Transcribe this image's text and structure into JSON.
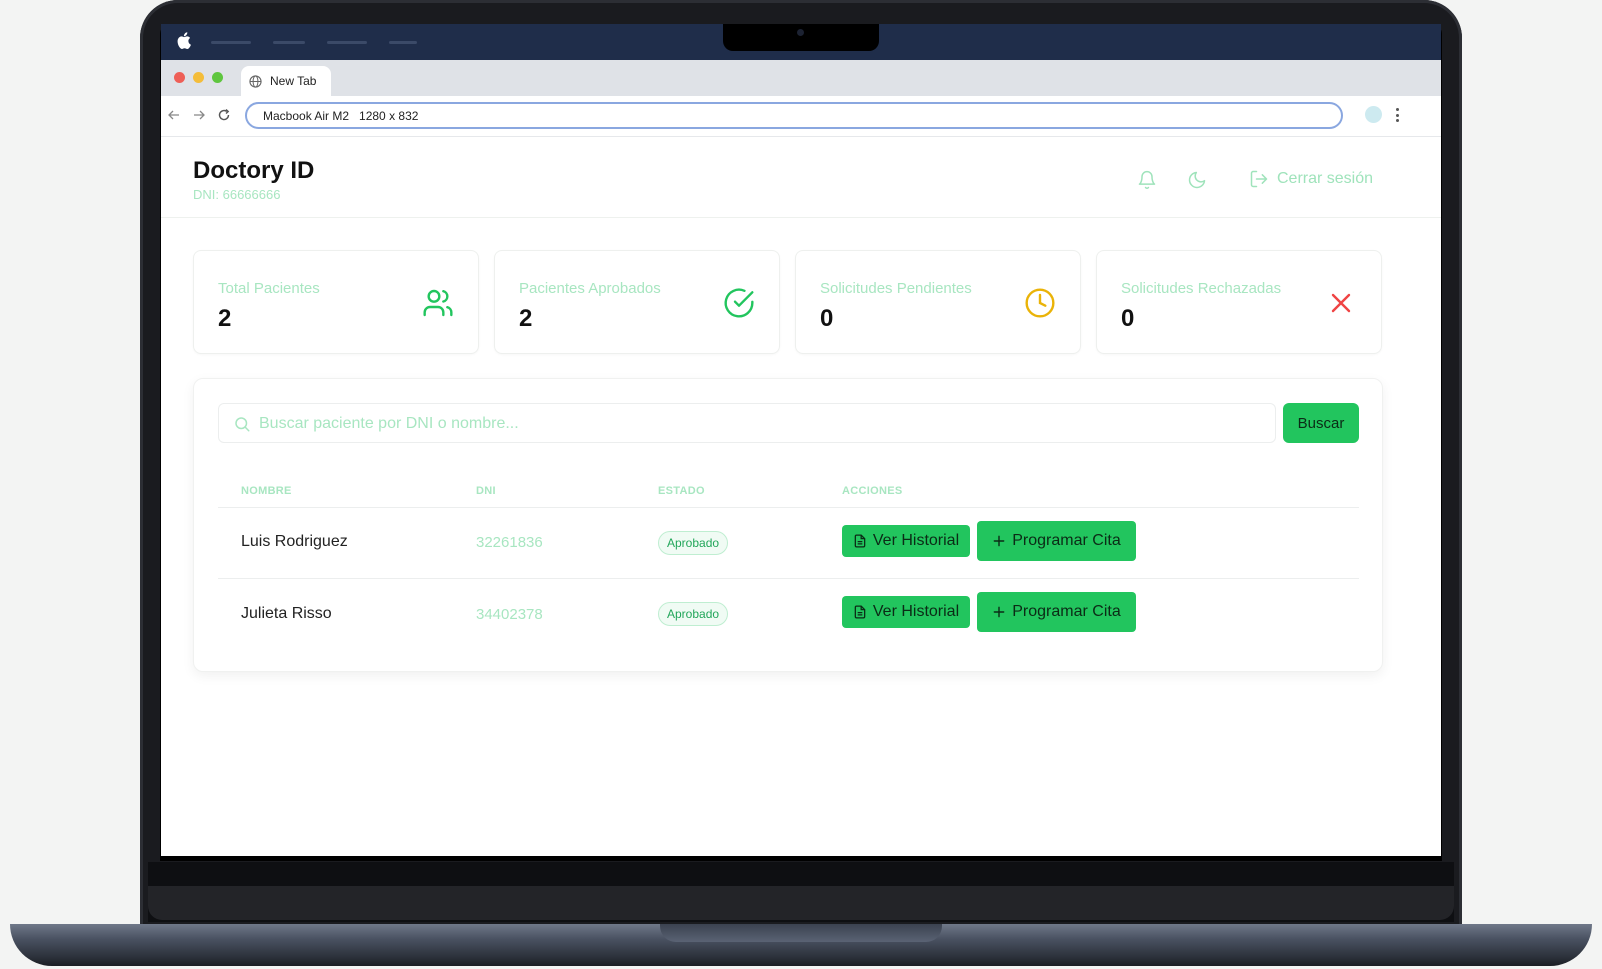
{
  "browser": {
    "tab_title": "New Tab",
    "url": "Macbook Air M2   1280 x 832"
  },
  "header": {
    "title": "Doctory ID",
    "dni": "DNI: 66666666",
    "logout_label": "Cerrar sesión"
  },
  "stats": [
    {
      "label": "Total Pacientes",
      "value": "2",
      "icon": "users-icon",
      "color": "#22c55e"
    },
    {
      "label": "Pacientes Aprobados",
      "value": "2",
      "icon": "check-circle-icon",
      "color": "#22c55e"
    },
    {
      "label": "Solicitudes Pendientes",
      "value": "0",
      "icon": "clock-icon",
      "color": "#eab308"
    },
    {
      "label": "Solicitudes Rechazadas",
      "value": "0",
      "icon": "x-icon",
      "color": "#ef4444"
    }
  ],
  "search": {
    "placeholder": "Buscar paciente por DNI o nombre...",
    "value": "",
    "button_label": "Buscar"
  },
  "table": {
    "columns": [
      "NOMBRE",
      "DNI",
      "ESTADO",
      "ACCIONES"
    ],
    "rows": [
      {
        "name": "Luis Rodriguez",
        "dni": "32261836",
        "status": "Aprobado",
        "action_history": "Ver Historial",
        "action_schedule": "Programar Cita"
      },
      {
        "name": "Julieta Risso",
        "dni": "34402378",
        "status": "Aprobado",
        "action_history": "Ver Historial",
        "action_schedule": "Programar Cita"
      }
    ]
  },
  "colors": {
    "accent": "#22c55e",
    "muted_accent": "#a8e6c1",
    "warning": "#eab308",
    "danger": "#ef4444"
  }
}
